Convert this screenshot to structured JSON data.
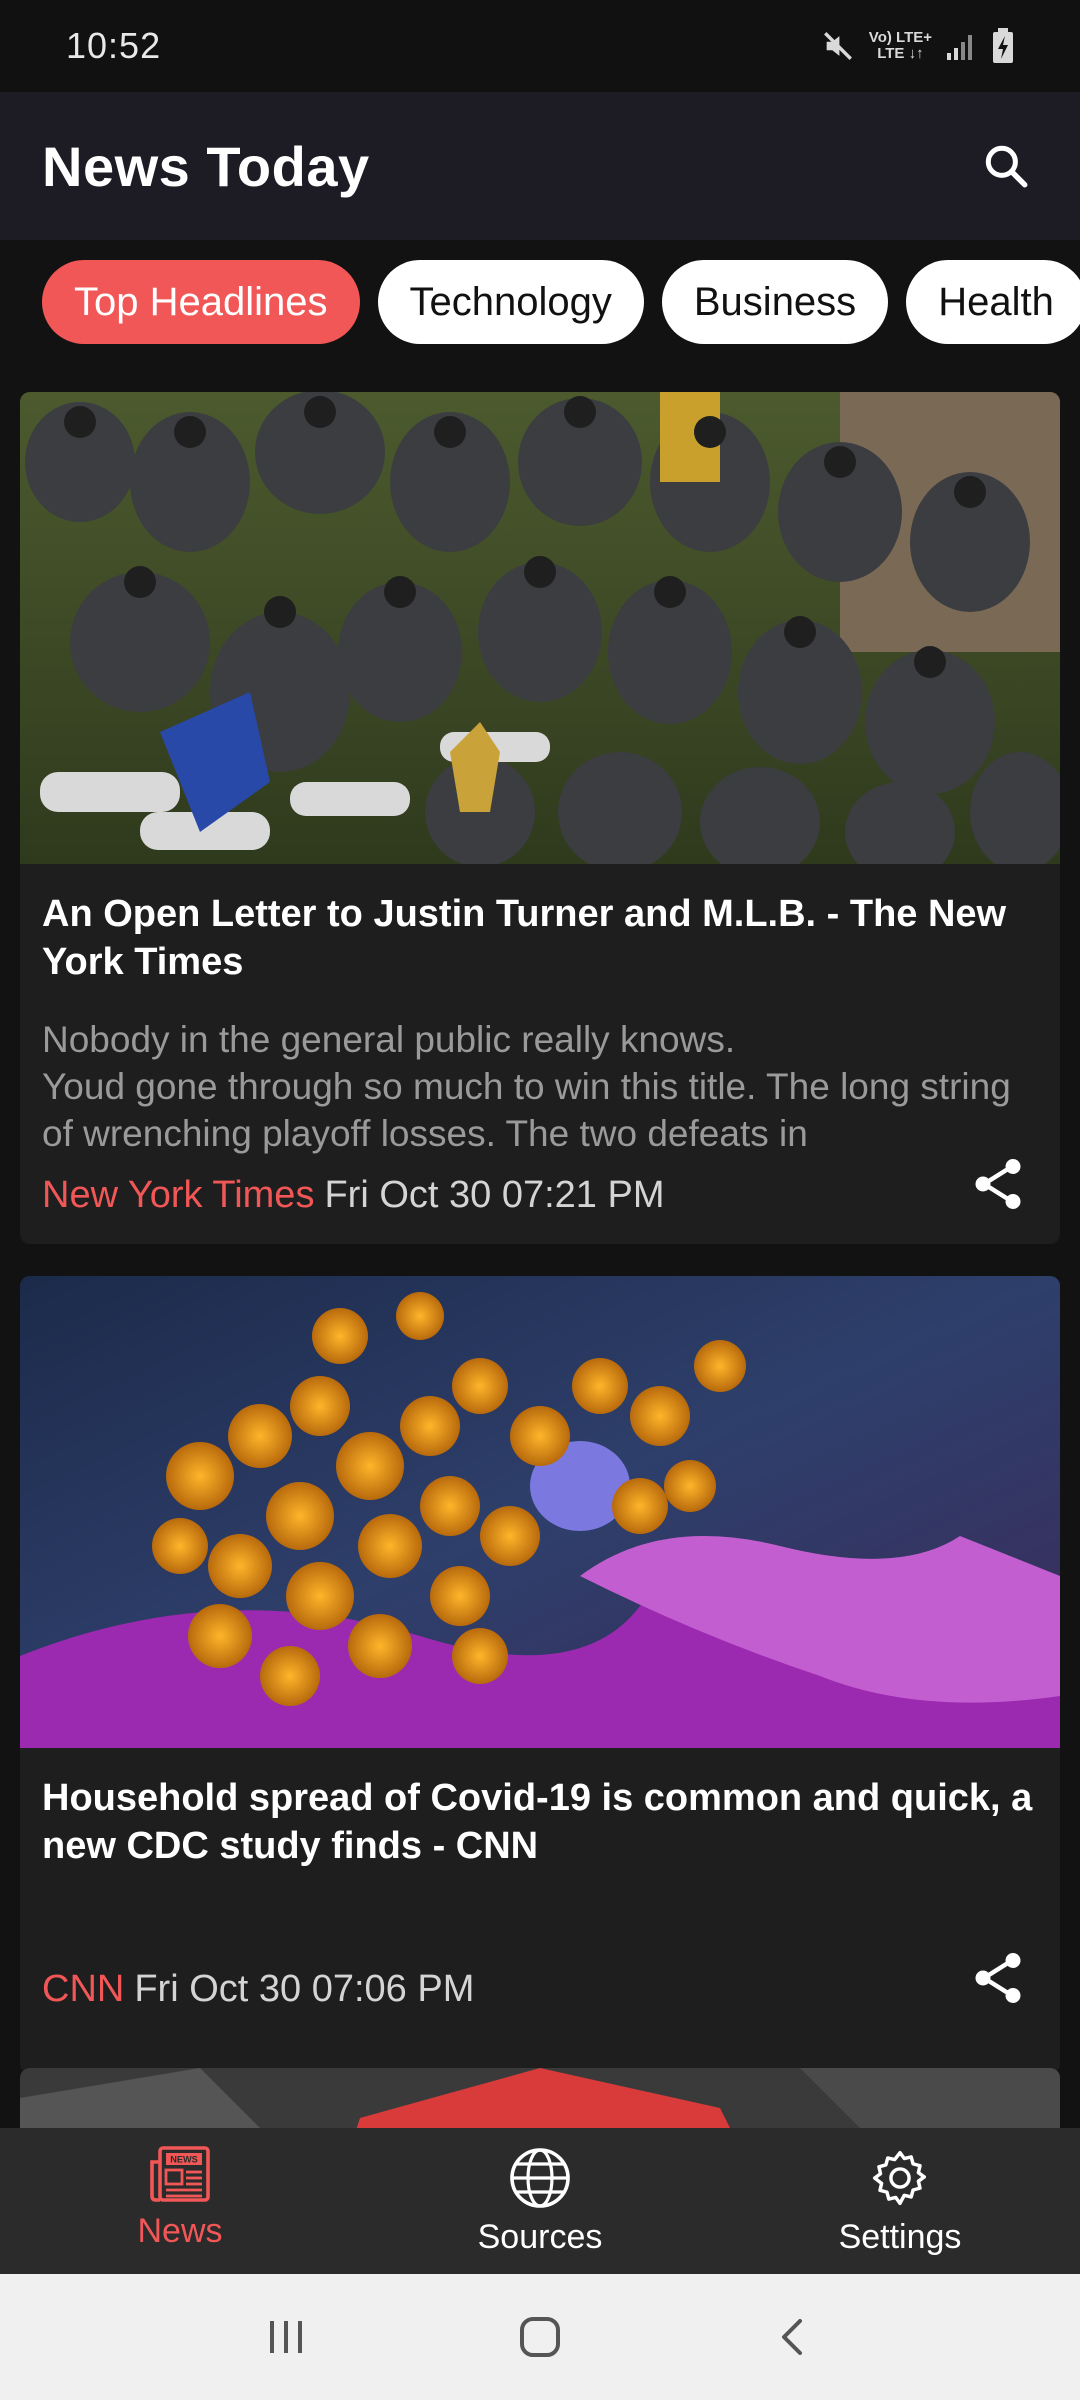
{
  "status_bar": {
    "time": "10:52",
    "network_top": "Vo) LTE+",
    "network_bottom": "LTE ↓↑"
  },
  "app_bar": {
    "title": "News Today",
    "search_icon": "search-icon"
  },
  "categories": [
    {
      "label": "Top Headlines",
      "active": true
    },
    {
      "label": "Technology",
      "active": false
    },
    {
      "label": "Business",
      "active": false
    },
    {
      "label": "Health",
      "active": false
    }
  ],
  "articles": [
    {
      "title": "An Open Letter to Justin Turner and M.L.B. - The New York Times",
      "description": "Nobody in the general public really knows.\nYoud gone through so much to win this title. The long string of wrenching playoff losses. The two defeats in",
      "source": "New York Times",
      "date": "Fri Oct 30 07:21 PM",
      "image": "team-celebration-photo"
    },
    {
      "title": "Household spread of Covid-19 is common and quick, a new CDC study finds - CNN",
      "description": "",
      "source": "CNN",
      "date": "Fri Oct 30 07:06 PM",
      "image": "virus-microscope-photo"
    }
  ],
  "bottom_nav": [
    {
      "label": "News",
      "icon": "newspaper-icon",
      "active": true
    },
    {
      "label": "Sources",
      "icon": "globe-icon",
      "active": false
    },
    {
      "label": "Settings",
      "icon": "gear-icon",
      "active": false
    }
  ],
  "colors": {
    "accent": "#f25757",
    "app_bar": "#1d1b24",
    "card": "#1e1e1e",
    "background": "#121212"
  }
}
